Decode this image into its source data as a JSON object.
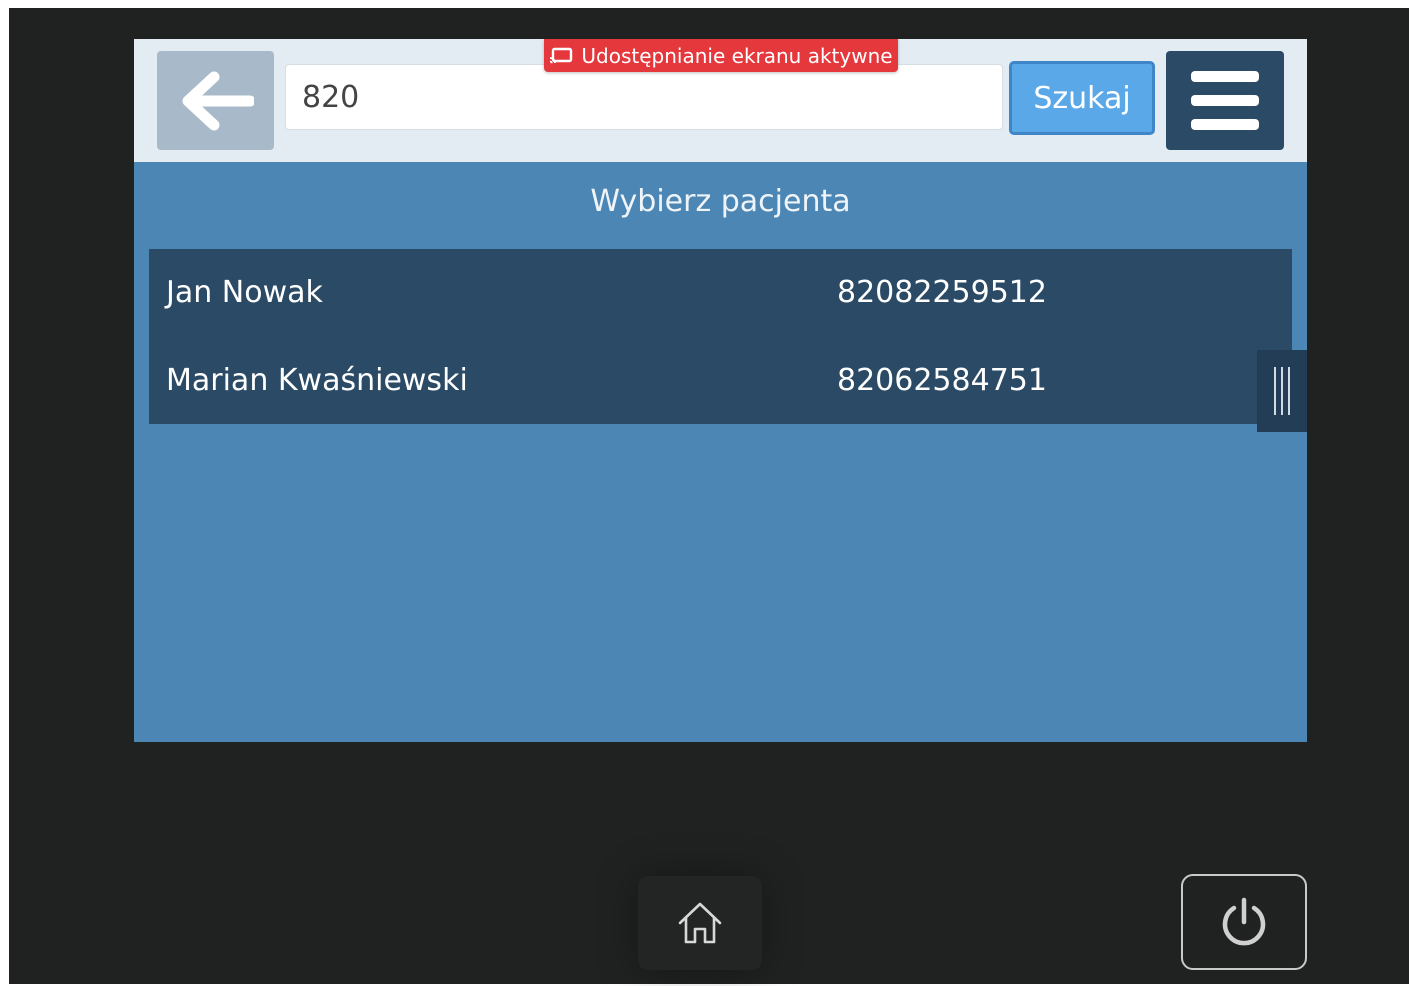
{
  "search": {
    "value": "820",
    "button_label": "Szukaj"
  },
  "screen_share": {
    "label": "Udostępnianie ekranu aktywne",
    "color": "#e5383d"
  },
  "page": {
    "title": "Wybierz pacjenta"
  },
  "patients": [
    {
      "name": "Jan Nowak",
      "pesel": "82082259512"
    },
    {
      "name": "Marian Kwaśniewski",
      "pesel": "82062584751"
    }
  ],
  "icons": {
    "back": "arrow-left-icon",
    "menu": "hamburger-menu-icon",
    "cast": "cast-screen-icon",
    "home": "home-icon",
    "power": "power-icon",
    "scroll": "scroll-handle-icon"
  },
  "colors": {
    "accent": "#5aa8e8",
    "panel": "#4c86b4",
    "list_bg": "#2a4a66",
    "menu_bg": "#2b4a65",
    "bezel": "#202221"
  }
}
